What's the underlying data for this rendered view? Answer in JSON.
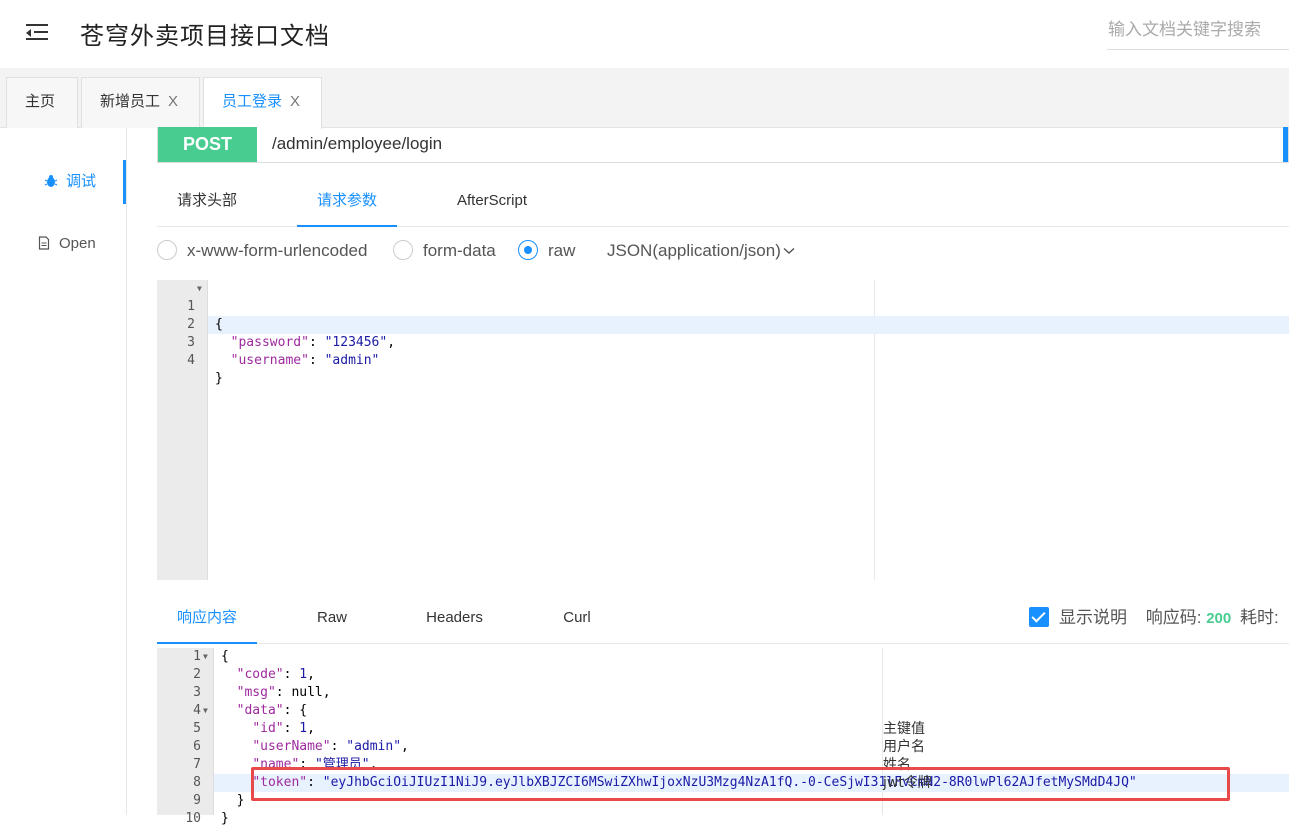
{
  "header": {
    "title": "苍穹外卖项目接口文档",
    "search_placeholder": "输入文档关键字搜索"
  },
  "tabs": [
    {
      "label": "主页",
      "closable": false
    },
    {
      "label": "新增员工",
      "close": "X"
    },
    {
      "label": "员工登录",
      "close": "X",
      "active": true
    }
  ],
  "sidebar": {
    "items": [
      {
        "label": "调试",
        "icon": "bug-icon",
        "active": true
      },
      {
        "label": "Open",
        "icon": "document-icon"
      }
    ]
  },
  "request": {
    "method": "POST",
    "url": "/admin/employee/login",
    "tabs": [
      "请求头部",
      "请求参数",
      "AfterScript"
    ],
    "active_tab": "请求参数",
    "body_types": [
      "x-www-form-urlencoded",
      "form-data",
      "raw"
    ],
    "selected_body_type": "raw",
    "content_type": "JSON(application/json)",
    "body_lines": [
      {
        "n": "1",
        "text": "{"
      },
      {
        "n": "2",
        "text": "  \"password\": \"123456\","
      },
      {
        "n": "3",
        "text": "  \"username\": \"admin\""
      },
      {
        "n": "4",
        "text": "}"
      }
    ]
  },
  "response": {
    "tabs": [
      "响应内容",
      "Raw",
      "Headers",
      "Curl"
    ],
    "active_tab": "响应内容",
    "show_description_label": "显示说明",
    "show_description_checked": true,
    "status_label": "响应码:",
    "status_code": "200",
    "time_label": "耗时:",
    "body_lines": [
      {
        "n": "1",
        "text": "{"
      },
      {
        "n": "2",
        "text": "  \"code\": 1,"
      },
      {
        "n": "3",
        "text": "  \"msg\": null,"
      },
      {
        "n": "4",
        "text": "  \"data\": {"
      },
      {
        "n": "5",
        "text": "    \"id\": 1,"
      },
      {
        "n": "6",
        "text": "    \"userName\": \"admin\","
      },
      {
        "n": "7",
        "text": "    \"name\": \"管理员\","
      },
      {
        "n": "8",
        "text": "    \"token\": \"eyJhbGciOiJIUzI1NiJ9.eyJlbXBJZCI6MSwiZXhwIjoxNzU3Mzg4NzA1fQ.-0-CeSjwI31lFvCmN2-8R0lwPl62AJfetMySMdD4JQ\""
      },
      {
        "n": "9",
        "text": "  }"
      },
      {
        "n": "10",
        "text": "}"
      }
    ],
    "notes": [
      {
        "line": 5,
        "text": "主键值"
      },
      {
        "line": 6,
        "text": "用户名"
      },
      {
        "line": 7,
        "text": "姓名"
      },
      {
        "line": 8,
        "text": "jwt令牌"
      }
    ]
  },
  "colors": {
    "accent": "#1890ff",
    "post": "#49cc90",
    "highlight_box": "#e84a4a"
  }
}
